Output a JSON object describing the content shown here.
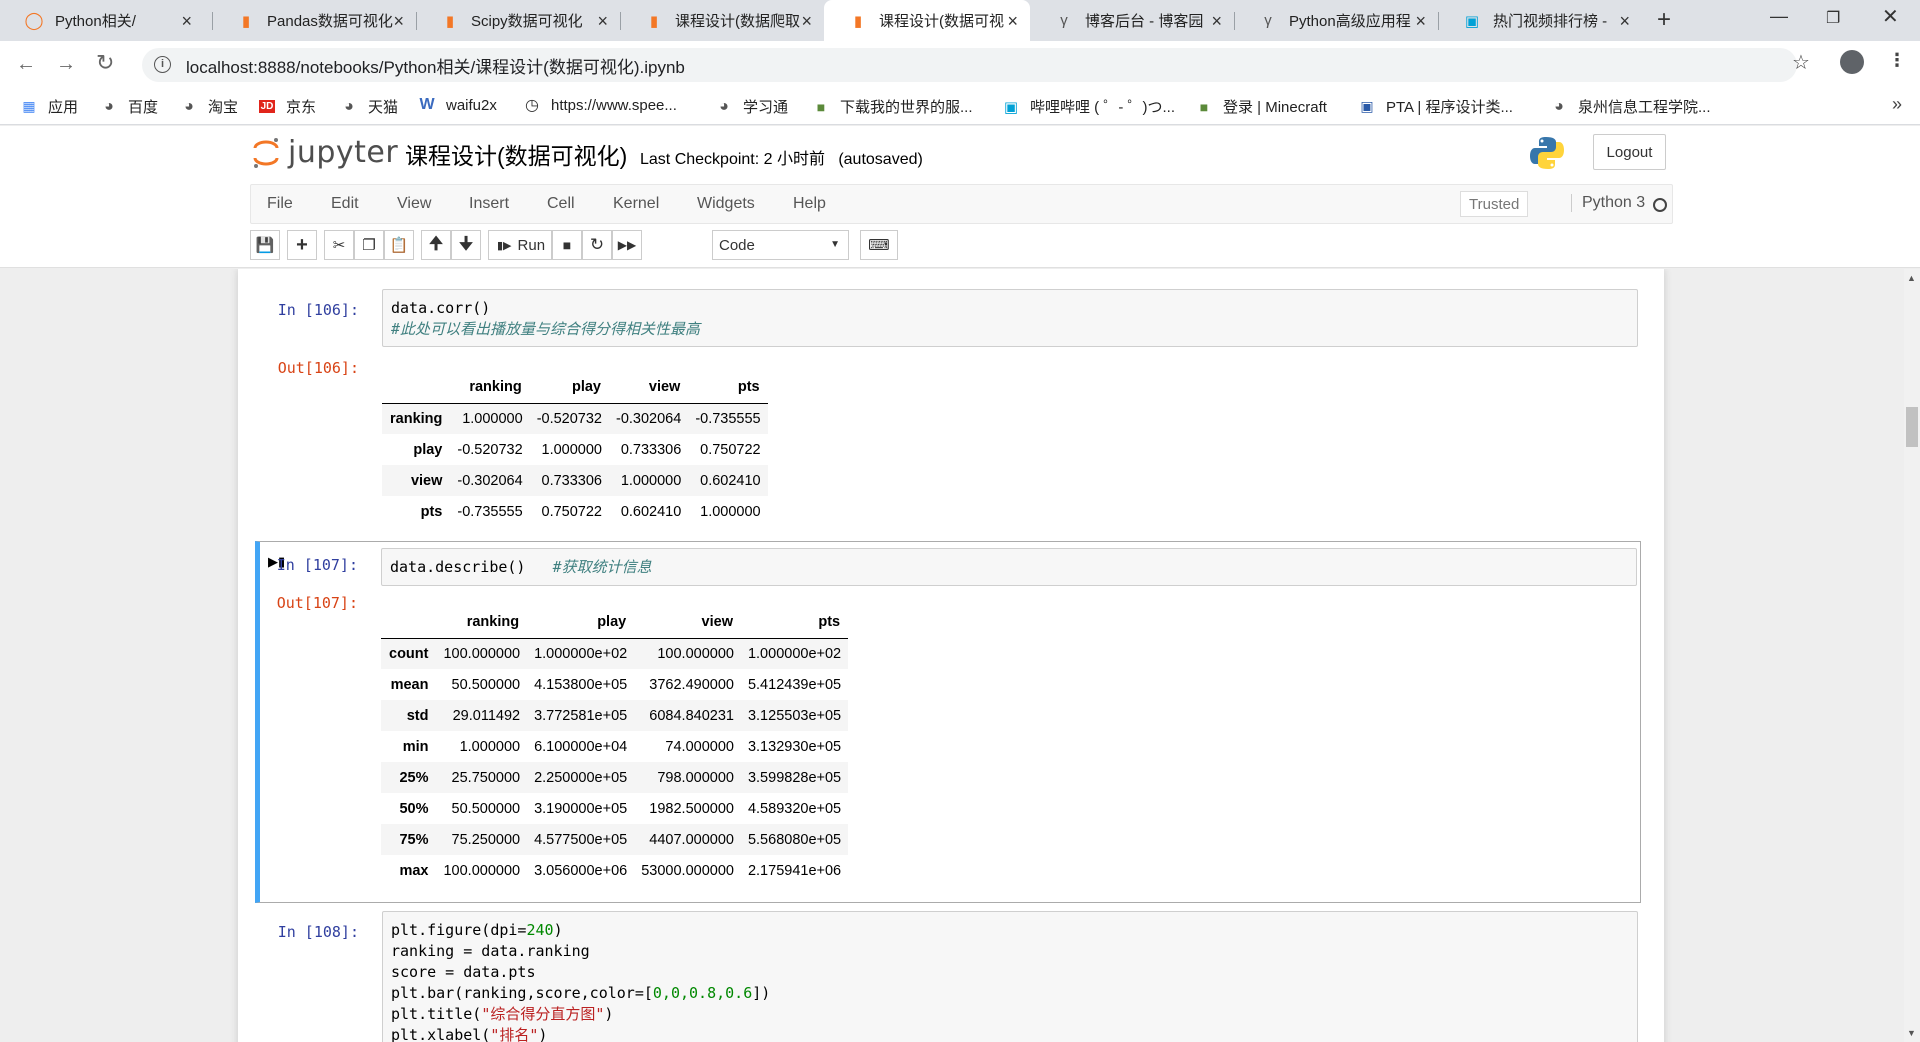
{
  "browser": {
    "tabs": [
      {
        "title": "Python相关/",
        "icon": "jupyter-icon",
        "active": false
      },
      {
        "title": "Pandas数据可视化",
        "icon": "notebook-icon",
        "active": false
      },
      {
        "title": "Scipy数据可视化",
        "icon": "notebook-icon",
        "active": false
      },
      {
        "title": "课程设计(数据爬取",
        "icon": "notebook-icon",
        "active": false
      },
      {
        "title": "课程设计(数据可视",
        "icon": "notebook-icon",
        "active": true
      },
      {
        "title": "博客后台 - 博客园",
        "icon": "cnblogs-icon",
        "active": false
      },
      {
        "title": "Python高级应用程",
        "icon": "cnblogs-icon",
        "active": false
      },
      {
        "title": "热门视频排行榜 - ",
        "icon": "bilibili-icon",
        "active": false
      }
    ],
    "url": "localhost:8888/notebooks/Python相关/课程设计(数据可视化).ipynb",
    "bookmarks": [
      {
        "label": "应用",
        "icon": "apps-grid-icon"
      },
      {
        "label": "百度",
        "icon": "globe-icon"
      },
      {
        "label": "淘宝",
        "icon": "globe-icon"
      },
      {
        "label": "京东",
        "icon": "jd-icon"
      },
      {
        "label": "天猫",
        "icon": "globe-icon"
      },
      {
        "label": "waifu2x",
        "icon": "w-icon"
      },
      {
        "label": "https://www.spee...",
        "icon": "speedometer-icon"
      },
      {
        "label": "学习通",
        "icon": "globe-icon"
      },
      {
        "label": "下载我的世界的服...",
        "icon": "minecraft-block-icon"
      },
      {
        "label": "哔哩哔哩 ( ゜- ゜)つ...",
        "icon": "bilibili-icon"
      },
      {
        "label": "登录 | Minecraft",
        "icon": "minecraft-block-icon"
      },
      {
        "label": "PTA | 程序设计类...",
        "icon": "pta-icon"
      },
      {
        "label": "泉州信息工程学院...",
        "icon": "globe-icon"
      }
    ],
    "more": "»"
  },
  "jupyter": {
    "logo_text": "jupyter",
    "notebook_name": "课程设计(数据可视化)",
    "checkpoint": "Last Checkpoint: 2 小时前",
    "autosaved": "(autosaved)",
    "logout": "Logout",
    "menu": [
      "File",
      "Edit",
      "View",
      "Insert",
      "Cell",
      "Kernel",
      "Widgets",
      "Help"
    ],
    "trusted": "Trusted",
    "kernel": "Python 3",
    "run_label": "Run",
    "cell_type": "Code"
  },
  "cells": {
    "c106": {
      "in_prompt": "In  [106]:",
      "out_prompt": "Out[106]:",
      "code_line1": "data.corr()",
      "code_line2": "#此处可以看出播放量与综合得分得相关性最高",
      "table": {
        "columns": [
          "",
          "ranking",
          "play",
          "view",
          "pts"
        ],
        "rows": [
          [
            "ranking",
            "1.000000",
            "-0.520732",
            "-0.302064",
            "-0.735555"
          ],
          [
            "play",
            "-0.520732",
            "1.000000",
            "0.733306",
            "0.750722"
          ],
          [
            "view",
            "-0.302064",
            "0.733306",
            "1.000000",
            "0.602410"
          ],
          [
            "pts",
            "-0.735555",
            "0.750722",
            "0.602410",
            "1.000000"
          ]
        ]
      }
    },
    "c107": {
      "in_prompt": "In  [107]:",
      "out_prompt": "Out[107]:",
      "code": "data.describe()",
      "comment": "#获取统计信息",
      "table": {
        "columns": [
          "",
          "ranking",
          "play",
          "view",
          "pts"
        ],
        "rows": [
          [
            "count",
            "100.000000",
            "1.000000e+02",
            "100.000000",
            "1.000000e+02"
          ],
          [
            "mean",
            "50.500000",
            "4.153800e+05",
            "3762.490000",
            "5.412439e+05"
          ],
          [
            "std",
            "29.011492",
            "3.772581e+05",
            "6084.840231",
            "3.125503e+05"
          ],
          [
            "min",
            "1.000000",
            "6.100000e+04",
            "74.000000",
            "3.132930e+05"
          ],
          [
            "25%",
            "25.750000",
            "2.250000e+05",
            "798.000000",
            "3.599828e+05"
          ],
          [
            "50%",
            "50.500000",
            "3.190000e+05",
            "1982.500000",
            "4.589320e+05"
          ],
          [
            "75%",
            "75.250000",
            "4.577500e+05",
            "4407.000000",
            "5.568080e+05"
          ],
          [
            "max",
            "100.000000",
            "3.056000e+06",
            "53000.000000",
            "2.175941e+06"
          ]
        ]
      }
    },
    "c108": {
      "in_prompt": "In  [108]:",
      "l1a": "plt.figure(dpi=",
      "l1n": "240",
      "l1b": ")",
      "l2": "ranking = data.ranking",
      "l3": "score = data.pts",
      "l4a": "plt.bar(ranking,score,color=[",
      "l4n": "0,0,0.8,0.6",
      "l4b": "])",
      "l5a": "plt.title(",
      "l5s": "\"综合得分直方图\"",
      "l5b": ")",
      "l6a": "plt.xlabel(",
      "l6s": "\"排名\"",
      "l6b": ")"
    }
  }
}
